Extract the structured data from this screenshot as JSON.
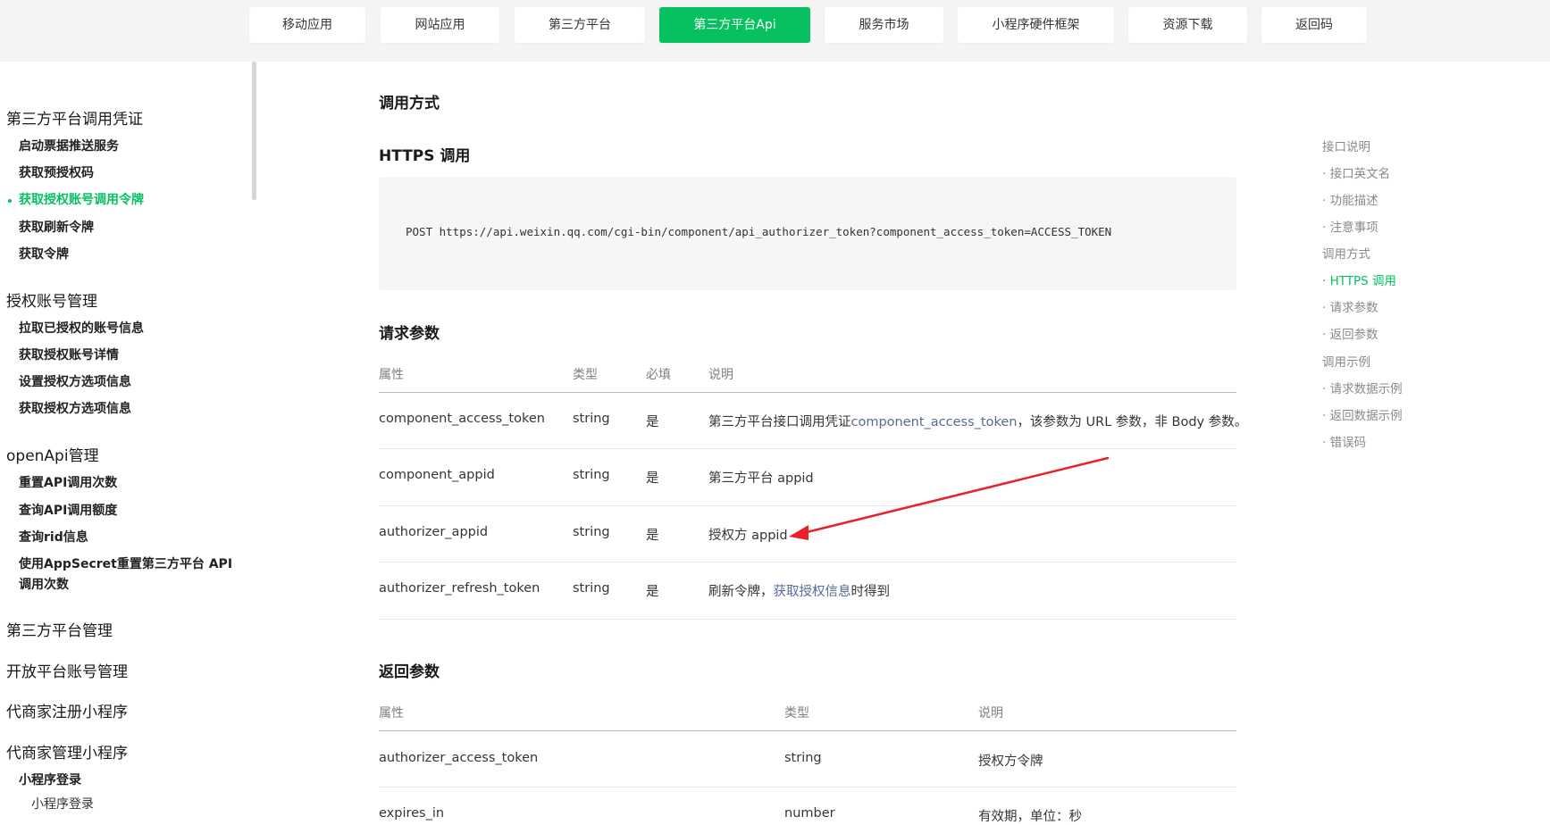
{
  "nav": {
    "tabs": [
      {
        "label": "移动应用",
        "active": false
      },
      {
        "label": "网站应用",
        "active": false
      },
      {
        "label": "第三方平台",
        "active": false
      },
      {
        "label": "第三方平台Api",
        "active": true
      },
      {
        "label": "服务市场",
        "active": false
      },
      {
        "label": "小程序硬件框架",
        "active": false
      },
      {
        "label": "资源下载",
        "active": false
      },
      {
        "label": "返回码",
        "active": false
      }
    ]
  },
  "sidebar": {
    "group1": "第三方平台调用凭证",
    "group1_items": [
      "启动票据推送服务",
      "获取预授权码",
      "获取授权账号调用令牌",
      "获取刷新令牌",
      "获取令牌"
    ],
    "group2": "授权账号管理",
    "group2_items": [
      "拉取已授权的账号信息",
      "获取授权账号详情",
      "设置授权方选项信息",
      "获取授权方选项信息"
    ],
    "group3": "openApi管理",
    "group3_items": [
      "重置API调用次数",
      "查询API调用额度",
      "查询rid信息",
      "使用AppSecret重置第三方平台 API",
      "调用次数"
    ],
    "group4": "第三方平台管理",
    "group5": "开放平台账号管理",
    "group6": "代商家注册小程序",
    "group7": "代商家管理小程序",
    "group7_items": [
      "小程序登录"
    ],
    "group7_sub": [
      "小程序登录"
    ]
  },
  "main": {
    "call_method_title": "调用方式",
    "https_title": "HTTPS 调用",
    "https_code": "POST https://api.weixin.qq.com/cgi-bin/component/api_authorizer_token?component_access_token=ACCESS_TOKEN",
    "request_title": "请求参数",
    "request_headers": [
      "属性",
      "类型",
      "必填",
      "说明"
    ],
    "request_rows": [
      {
        "name": "component_access_token",
        "type": "string",
        "required": "是",
        "desc_pre": "第三方平台接口调用凭证",
        "desc_link": "component_access_token",
        "desc_post": "，该参数为 URL 参数，非 Body 参数。"
      },
      {
        "name": "component_appid",
        "type": "string",
        "required": "是",
        "desc_pre": "第三方平台 appid",
        "desc_link": "",
        "desc_post": ""
      },
      {
        "name": "authorizer_appid",
        "type": "string",
        "required": "是",
        "desc_pre": "授权方 appid",
        "desc_link": "",
        "desc_post": ""
      },
      {
        "name": "authorizer_refresh_token",
        "type": "string",
        "required": "是",
        "desc_pre": "刷新令牌，",
        "desc_link": "获取授权信息",
        "desc_post": "时得到"
      }
    ],
    "response_title": "返回参数",
    "response_headers": [
      "属性",
      "类型",
      "说明"
    ],
    "response_rows": [
      {
        "name": "authorizer_access_token",
        "type": "string",
        "desc": "授权方令牌"
      },
      {
        "name": "expires_in",
        "type": "number",
        "desc": "有效期，单位：秒"
      }
    ]
  },
  "toc": {
    "items": [
      {
        "label": "接口说明",
        "active": false
      },
      {
        "label": "· 接口英文名",
        "active": false
      },
      {
        "label": "· 功能描述",
        "active": false
      },
      {
        "label": "· 注意事项",
        "active": false
      },
      {
        "label": "调用方式",
        "active": false
      },
      {
        "label": "· HTTPS 调用",
        "active": true
      },
      {
        "label": "· 请求参数",
        "active": false
      },
      {
        "label": "· 返回参数",
        "active": false
      },
      {
        "label": "调用示例",
        "active": false
      },
      {
        "label": "· 请求数据示例",
        "active": false
      },
      {
        "label": "· 返回数据示例",
        "active": false
      },
      {
        "label": "· 错误码",
        "active": false
      }
    ]
  },
  "colors": {
    "accent": "#07c160",
    "link": "#576b95",
    "annotation": "#e8212b"
  }
}
